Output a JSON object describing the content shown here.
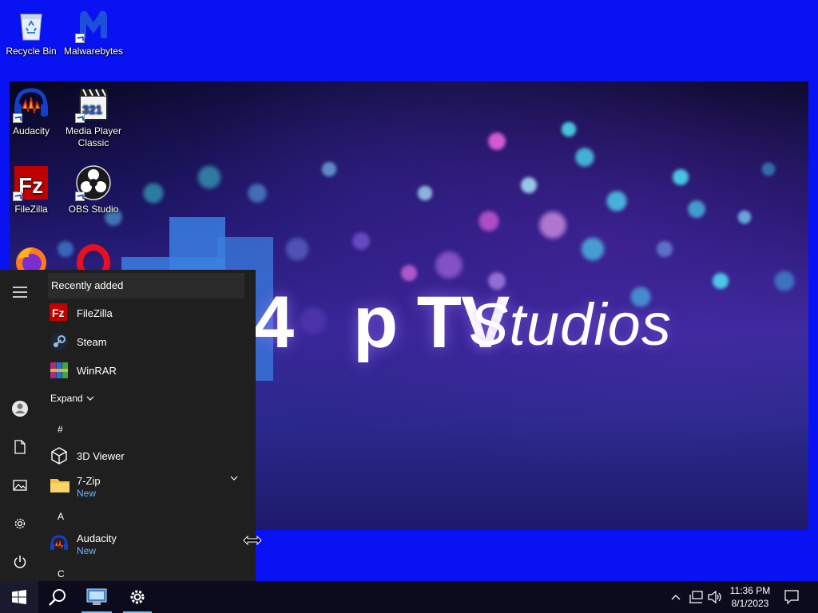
{
  "desktop": {
    "icons": [
      {
        "label": "Recycle Bin",
        "icon": "recycle-bin-icon"
      },
      {
        "label": "Malwarebytes",
        "icon": "malwarebytes-icon"
      },
      {
        "label": "Audacity",
        "icon": "audacity-icon"
      },
      {
        "label": "Media Player Classic",
        "icon": "media-player-classic-icon"
      },
      {
        "label": "FileZilla",
        "icon": "filezilla-icon"
      },
      {
        "label": "OBS Studio",
        "icon": "obs-studio-icon"
      },
      {
        "label": "",
        "icon": "firefox-icon"
      },
      {
        "label": "",
        "icon": "opera-icon"
      }
    ],
    "wallpaper": {
      "title": "p TV",
      "title_prefix": "4",
      "subtitle": "Studios",
      "colors": {
        "bg": "#1b1460",
        "accent": "#3a7fe0"
      }
    },
    "background_color": "#0812f2"
  },
  "start_menu": {
    "recently_added_label": "Recently added",
    "recent_apps": [
      {
        "label": "FileZilla",
        "icon": "filezilla-icon"
      },
      {
        "label": "Steam",
        "icon": "steam-icon"
      },
      {
        "label": "WinRAR",
        "icon": "winrar-icon"
      }
    ],
    "expand_label": "Expand",
    "sections": [
      {
        "letter": "#"
      },
      {
        "letter": "A"
      },
      {
        "letter": "C"
      }
    ],
    "apps": [
      {
        "label": "3D Viewer",
        "badge": "",
        "icon": "3d-viewer-icon"
      },
      {
        "label": "7-Zip",
        "badge": "New",
        "icon": "folder-icon"
      },
      {
        "label": "Audacity",
        "badge": "New",
        "icon": "audacity-icon"
      }
    ],
    "rail": [
      "hamburger-icon",
      "user-icon",
      "documents-icon",
      "pictures-icon",
      "settings-icon",
      "power-icon"
    ]
  },
  "taskbar": {
    "clock_time": "11:36 PM",
    "clock_date": "8/1/2023",
    "items": [
      "start-icon",
      "search-icon",
      "explorer-icon",
      "settings-icon"
    ],
    "accent": "#76b9ed"
  }
}
